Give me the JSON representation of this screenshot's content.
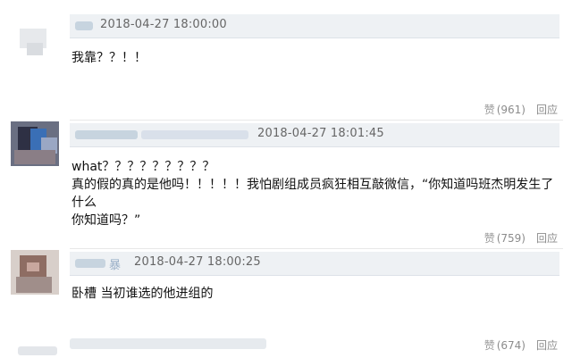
{
  "comments": [
    {
      "time": "2018-04-27 18:00:00",
      "text": "我靠？？！！",
      "like_icon": "thumb-up-icon",
      "like_glyph": "赞",
      "like_count": "(961)",
      "reply_label": "回应"
    },
    {
      "time": "2018-04-27 18:01:45",
      "text_line1": "what？？？？？？？？？",
      "text_line2": "真的假的真的是他吗！！！！！我怕剧组成员疯狂相互敲微信，“你知道吗班杰明发生了什么",
      "text_line3": "你知道吗？”",
      "like_icon": "thumb-up-icon",
      "like_glyph": "赞",
      "like_count": "(759)",
      "reply_label": "回应"
    },
    {
      "time": "2018-04-27 18:00:25",
      "name_tail": "暴",
      "text": "卧槽 当初谁选的他进组的",
      "like_icon": "thumb-up-icon",
      "like_glyph": "赞",
      "like_count": "(674)",
      "reply_label": "回应"
    }
  ],
  "colors": {
    "header_bg": "#eef1f4",
    "meta_text": "#666666",
    "action_text": "#8c8c8c"
  }
}
